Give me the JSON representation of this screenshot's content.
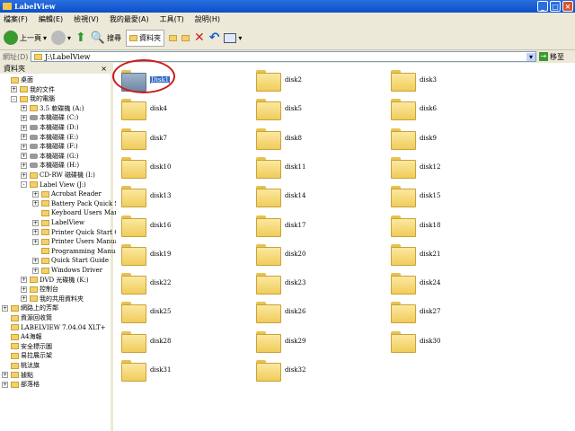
{
  "window": {
    "title": "LabelView"
  },
  "menu": [
    "檔案(F)",
    "編輯(E)",
    "檢視(V)",
    "我的最愛(A)",
    "工具(T)",
    "說明(H)"
  ],
  "toolbar": {
    "back": "上一頁",
    "search": "搜尋",
    "folders": "資料夾"
  },
  "address": {
    "label": "網址(D)",
    "value": "J:\\LabelView",
    "go": "移至"
  },
  "folder_pane": {
    "title": "資料夾",
    "close": "×",
    "items": [
      {
        "label": "桌面",
        "level": 0,
        "exp": ""
      },
      {
        "label": "我的文件",
        "level": 1,
        "exp": "+"
      },
      {
        "label": "我的電腦",
        "level": 1,
        "exp": "-"
      },
      {
        "label": "3.5 軟碟機 (A:)",
        "level": 2,
        "exp": "+"
      },
      {
        "label": "本機磁碟 (C:)",
        "level": 2,
        "exp": "+"
      },
      {
        "label": "本機磁碟 (D:)",
        "level": 2,
        "exp": "+"
      },
      {
        "label": "本機磁碟 (E:)",
        "level": 2,
        "exp": "+"
      },
      {
        "label": "本機磁碟 (F:)",
        "level": 2,
        "exp": "+"
      },
      {
        "label": "本機磁碟 (G:)",
        "level": 2,
        "exp": "+"
      },
      {
        "label": "本機磁碟 (H:)",
        "level": 2,
        "exp": "+"
      },
      {
        "label": "CD-RW 磁碟機 (I:)",
        "level": 2,
        "exp": "+"
      },
      {
        "label": "Label View (J:)",
        "level": 2,
        "exp": "-"
      },
      {
        "label": "Acrobat Reader",
        "level": 3,
        "exp": "+"
      },
      {
        "label": "Battery Pack Quick Start Guide",
        "level": 3,
        "exp": "+"
      },
      {
        "label": "Keyboard Users Manual",
        "level": 3,
        "exp": ""
      },
      {
        "label": "LabelView",
        "level": 3,
        "exp": "+"
      },
      {
        "label": "Printer Quick Start Guide",
        "level": 3,
        "exp": "+"
      },
      {
        "label": "Printer Users Manual",
        "level": 3,
        "exp": "+"
      },
      {
        "label": "Programming Manual",
        "level": 3,
        "exp": ""
      },
      {
        "label": "Quick Start Guide",
        "level": 3,
        "exp": "+"
      },
      {
        "label": "Windows Driver",
        "level": 3,
        "exp": "+"
      },
      {
        "label": "DVD 光碟機 (K:)",
        "level": 2,
        "exp": "+"
      },
      {
        "label": "控制台",
        "level": 2,
        "exp": "+"
      },
      {
        "label": "我的共用資料夾",
        "level": 2,
        "exp": "+"
      },
      {
        "label": "網路上的芳鄰",
        "level": 0,
        "exp": "+"
      },
      {
        "label": "資源回收筒",
        "level": 0,
        "exp": ""
      },
      {
        "label": "LABELVIEW 7.04.04 XLT+",
        "level": 0,
        "exp": ""
      },
      {
        "label": "A4海報",
        "level": 0,
        "exp": ""
      },
      {
        "label": "安全標示圖",
        "level": 0,
        "exp": ""
      },
      {
        "label": "易拉展示架",
        "level": 0,
        "exp": ""
      },
      {
        "label": "桃汰旗",
        "level": 0,
        "exp": ""
      },
      {
        "label": "據點",
        "level": 0,
        "exp": "+"
      },
      {
        "label": "部落格",
        "level": 0,
        "exp": "+"
      }
    ]
  },
  "files": [
    "Disk1",
    "disk2",
    "disk3",
    "disk4",
    "disk5",
    "disk6",
    "disk7",
    "disk8",
    "disk9",
    "disk10",
    "disk11",
    "disk12",
    "disk13",
    "disk14",
    "disk15",
    "disk16",
    "disk17",
    "disk18",
    "disk19",
    "disk20",
    "disk21",
    "disk22",
    "disk23",
    "disk24",
    "disk25",
    "disk26",
    "disk27",
    "disk28",
    "disk29",
    "disk30",
    "disk31",
    "disk32"
  ],
  "selected_file": "Disk1"
}
